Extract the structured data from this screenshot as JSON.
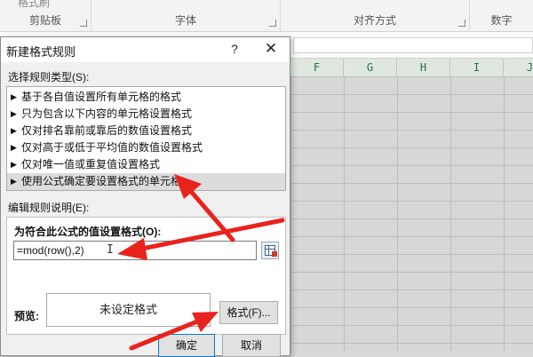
{
  "ribbon": {
    "cut_partial": "格式刷",
    "groups": [
      {
        "label": "剪贴板"
      },
      {
        "label": "字体"
      },
      {
        "label": "对齐方式"
      },
      {
        "label": "数字"
      }
    ]
  },
  "sheet": {
    "columns": [
      "F",
      "G",
      "H",
      "I",
      "J"
    ]
  },
  "dialog": {
    "title": "新建格式规则",
    "help": "?",
    "close": "✕",
    "rule_type_label": "选择规则类型(S):",
    "rule_types": [
      "基于各自值设置所有单元格的格式",
      "只为包含以下内容的单元格设置格式",
      "仅对排名靠前或靠后的数值设置格式",
      "仅对高于或低于平均值的数值设置格式",
      "仅对唯一值或重复值设置格式",
      "使用公式确定要设置格式的单元格"
    ],
    "selected_rule_index": 5,
    "edit_label": "编辑规则说明(E):",
    "formula_label": "为符合此公式的值设置格式(O):",
    "formula_value": "=mod(row(),2)",
    "preview_label": "预览:",
    "preview_text": "未设定格式",
    "format_button": "格式(F)...",
    "ok_button": "确定",
    "cancel_button": "取消"
  },
  "colors": {
    "annotation_arrow": "#e8231d",
    "selected_rule_bg": "#dcdcdc",
    "column_header_text": "#217346"
  }
}
